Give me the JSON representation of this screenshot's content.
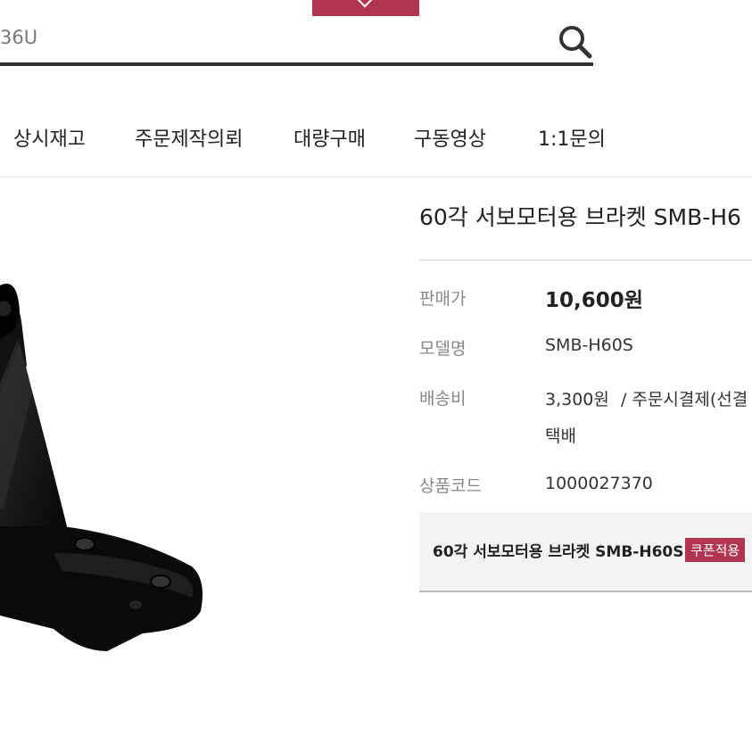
{
  "search": {
    "value": "36U"
  },
  "nav": {
    "items": [
      "상시재고",
      "주문제작의뢰",
      "대량구매",
      "구동영상",
      "1:1문의"
    ]
  },
  "product": {
    "title": "60각 서보모터용 브라켓 SMB-H6",
    "price_label": "판매가",
    "price": "10,600원",
    "model_label": "모델명",
    "model": "SMB-H60S",
    "shipping_label": "배송비",
    "shipping_fee": "3,300원",
    "shipping_method": "/ 주문시결제(선결",
    "shipping_type": "택배",
    "code_label": "상품코드",
    "code": "1000027370"
  },
  "option": {
    "name": "60각 서보모터용 브라켓 SMB-H60S",
    "badge": "쿠폰적용"
  },
  "colors": {
    "accent": "#b2354f",
    "text": "#222222",
    "label": "#888888"
  },
  "icons": {
    "search": "search-icon",
    "top_tab": "chevron-down-icon"
  }
}
